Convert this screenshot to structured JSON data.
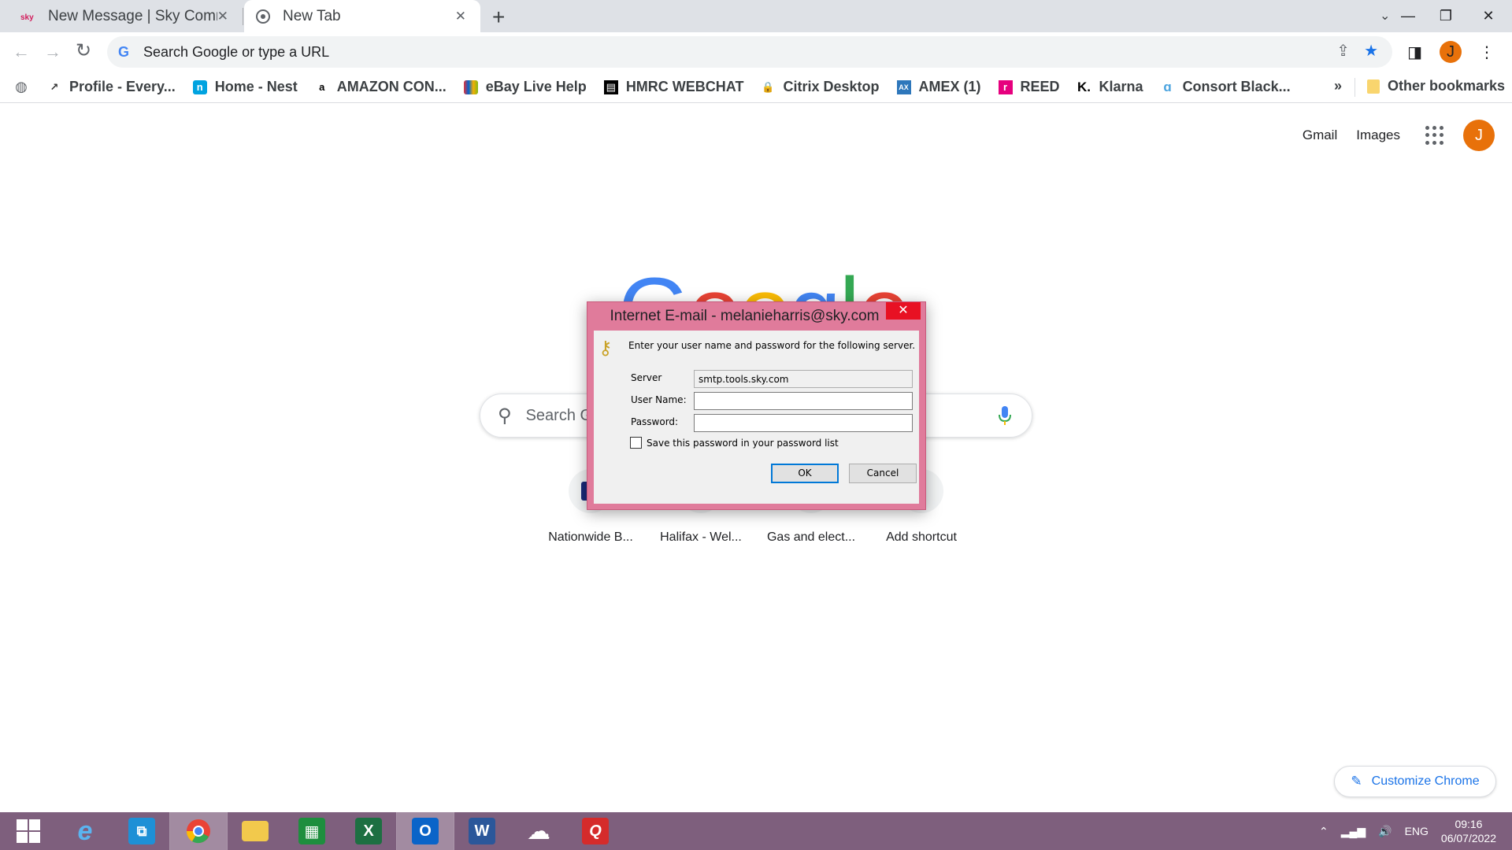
{
  "tabs": [
    {
      "title": "New Message | Sky Comm",
      "close": "✕"
    },
    {
      "title": "New Tab",
      "close": "✕"
    }
  ],
  "toolbar": {
    "omnibox_placeholder": "Search Google or type a URL",
    "profile_initial": "J"
  },
  "bookmarks": [
    {
      "label": "Profile - Every...",
      "icon": "profile-bookmark-icon"
    },
    {
      "label": "Home - Nest",
      "icon": "nest-icon"
    },
    {
      "label": "AMAZON CON...",
      "icon": "amazon-icon"
    },
    {
      "label": "eBay Live Help",
      "icon": "ebay-icon"
    },
    {
      "label": "HMRC WEBCHAT",
      "icon": "hmrc-icon"
    },
    {
      "label": "Citrix Desktop",
      "icon": "citrix-icon"
    },
    {
      "label": "AMEX (1)",
      "icon": "amex-icon"
    },
    {
      "label": "REED",
      "icon": "reed-icon"
    },
    {
      "label": "Klarna",
      "icon": "klarna-icon"
    },
    {
      "label": "Consort Black...",
      "icon": "consort-icon"
    }
  ],
  "bookmarks_more": "»",
  "other_bookmarks": "Other bookmarks",
  "page": {
    "gmail": "Gmail",
    "images": "Images",
    "avatar_initial": "J",
    "logo": "Google",
    "search_placeholder": "Search G",
    "shortcuts": [
      {
        "label": "Nationwide B..."
      },
      {
        "label": "Halifax - Wel..."
      },
      {
        "label": "Gas and elect..."
      },
      {
        "label": "Add shortcut"
      }
    ],
    "customize": "Customize Chrome"
  },
  "dialog": {
    "title": "Internet E-mail - melanieharris@sky.com",
    "close": "✕",
    "prompt": "Enter your user name and password for the following server.",
    "server_label": "Server",
    "server_value": "smtp.tools.sky.com",
    "username_label": "User Name:",
    "username_value": "",
    "password_label": "Password:",
    "password_value": "",
    "save_label": "Save this password in your password list",
    "save_checked": false,
    "ok": "OK",
    "cancel": "Cancel"
  },
  "taskbar": {
    "lang": "ENG",
    "time": "09:16",
    "date": "06/07/2022"
  },
  "colors": {
    "dialog_frame": "#e07b9b",
    "taskbar": "#7e5f7d",
    "accent_blue": "#1a73e8",
    "avatar_orange": "#e8710a"
  }
}
